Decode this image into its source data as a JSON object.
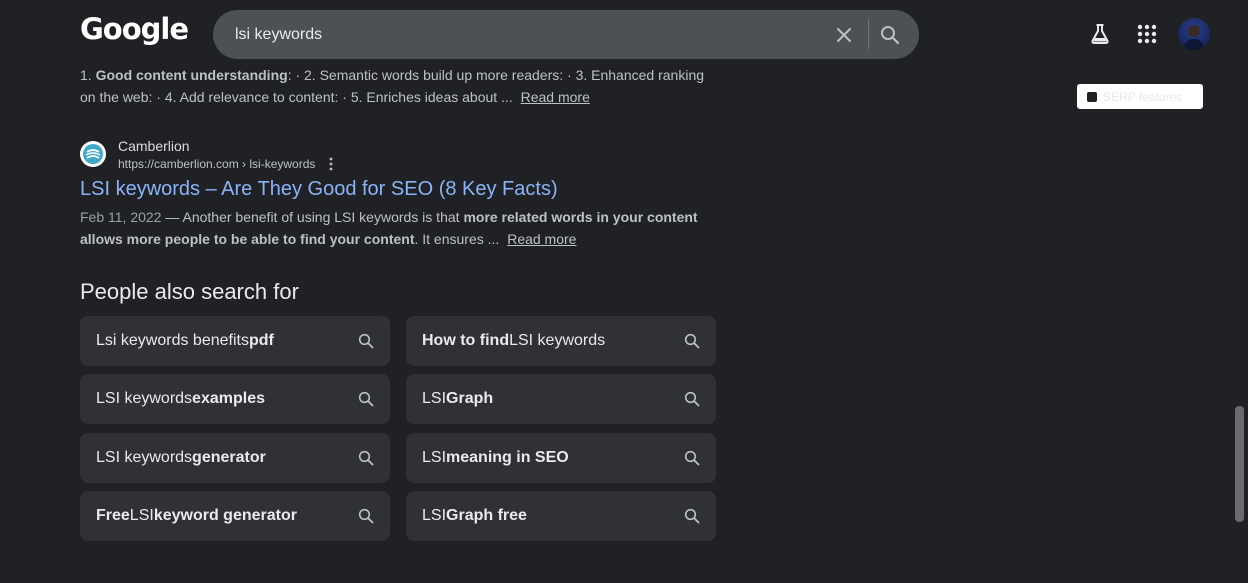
{
  "header": {
    "logo_text": "Google",
    "search_value": "lsi keywords",
    "serp_features_label": "SERP features"
  },
  "top_snippet": {
    "parts": [
      "1. ",
      "Good content understanding",
      ": · 2. Semantic words build up more readers: · 3. Enhanced ranking on the web: · 4. Add relevance to content: · 5. Enriches ideas about ..."
    ],
    "read_more": "Read more"
  },
  "result": {
    "site_name": "Camberlion",
    "url": "https://camberlion.com › lsi-keywords",
    "title": "LSI keywords – Are They Good for SEO (8 Key Facts)",
    "date": "Feb 11, 2022",
    "snippet_parts": [
      " — Another benefit of using LSI keywords is that ",
      "more related words in your content allows more people to be able to find your content",
      ". It ensures ..."
    ],
    "read_more": "Read more"
  },
  "people_also_search": {
    "heading": "People also search for",
    "chips": [
      {
        "normal1": "Lsi keywords benefits ",
        "bold1": "pdf",
        "normal2": ""
      },
      {
        "normal1": "",
        "bold1": "How to find",
        "normal2": " LSI keywords"
      },
      {
        "normal1": "LSI keywords ",
        "bold1": "examples",
        "normal2": ""
      },
      {
        "normal1": "LSI ",
        "bold1": "Graph",
        "normal2": ""
      },
      {
        "normal1": "LSI keywords ",
        "bold1": "generator",
        "normal2": ""
      },
      {
        "normal1": "LSI ",
        "bold1": "meaning in SEO",
        "normal2": ""
      },
      {
        "normal1": "",
        "bold1": "Free",
        "normal2": " LSI ",
        "bold2": "keyword generator"
      },
      {
        "normal1": "LSI ",
        "bold1": "Graph free",
        "normal2": ""
      }
    ]
  },
  "icons": {
    "clear": "close-icon",
    "search": "search-icon",
    "labs": "flask-icon",
    "apps": "apps-grid-icon",
    "more": "more-vert-icon"
  },
  "colors": {
    "background": "#202124",
    "link": "#8ab4f8",
    "chip": "#303134"
  }
}
